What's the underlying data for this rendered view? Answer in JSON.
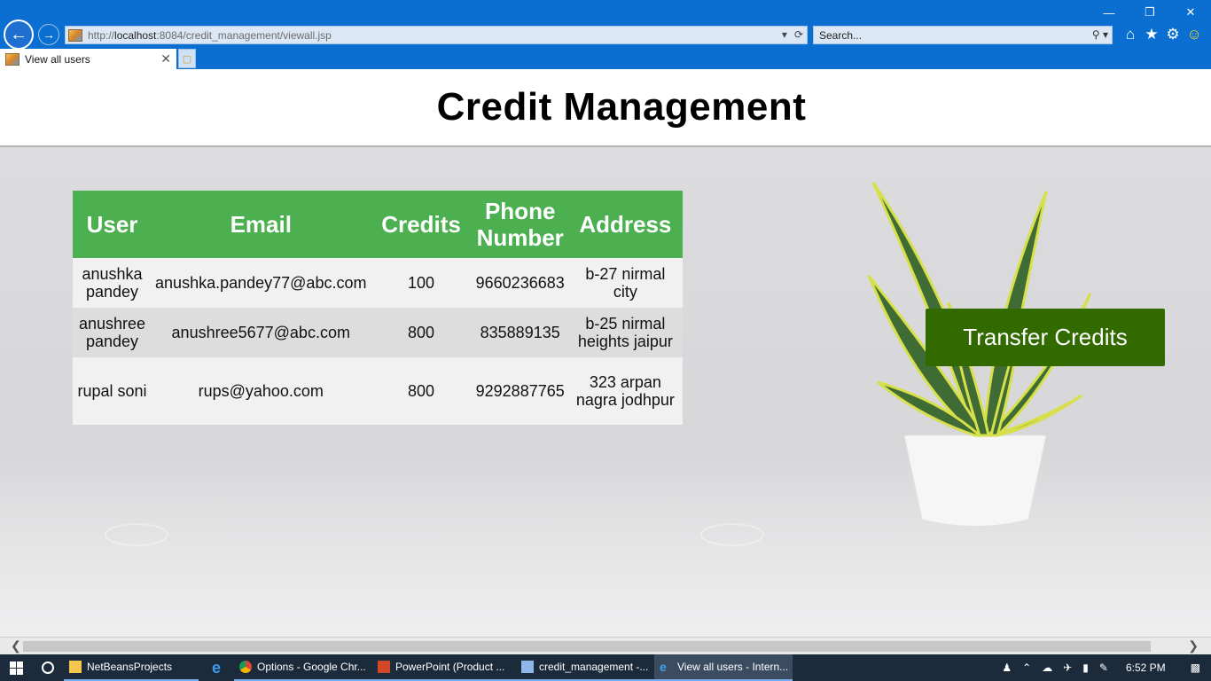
{
  "browser": {
    "url_scheme": "http://",
    "url_host": "localhost",
    "url_rest": ":8084/credit_management/viewall.jsp",
    "search_placeholder": "Search...",
    "tab_label": "View all users"
  },
  "page": {
    "title": "Credit Management",
    "transfer_button_label": "Transfer Credits"
  },
  "table": {
    "headers": [
      "User",
      "Email",
      "Credits",
      "Phone Number",
      "Address"
    ],
    "rows": [
      {
        "user": "anushka pandey",
        "email": "anushka.pandey77@abc.com",
        "credits": "100",
        "phone": "9660236683",
        "address": "b-27 nirmal city"
      },
      {
        "user": "anushree pandey",
        "email": "anushree5677@abc.com",
        "credits": "800",
        "phone": "835889135",
        "address": "b-25 nirmal heights jaipur"
      },
      {
        "user": "rupal soni",
        "email": "rups@yahoo.com",
        "credits": "800",
        "phone": "9292887765",
        "address": "323 arpan nagra jodhpur"
      }
    ]
  },
  "taskbar": {
    "items": [
      {
        "label": "NetBeansProjects",
        "icon": "folder-icon"
      },
      {
        "label": "",
        "icon": "edge-icon"
      },
      {
        "label": "Options - Google Chr...",
        "icon": "chrome-icon"
      },
      {
        "label": "PowerPoint (Product ...",
        "icon": "powerpoint-icon"
      },
      {
        "label": "credit_management -...",
        "icon": "netbeans-icon"
      },
      {
        "label": "View all users - Intern...",
        "icon": "internet-explorer-icon"
      }
    ],
    "clock": "6:52 PM"
  },
  "colors": {
    "chrome_blue": "#0a6fd0",
    "table_header": "#4caf50",
    "transfer_button": "#336a00"
  }
}
